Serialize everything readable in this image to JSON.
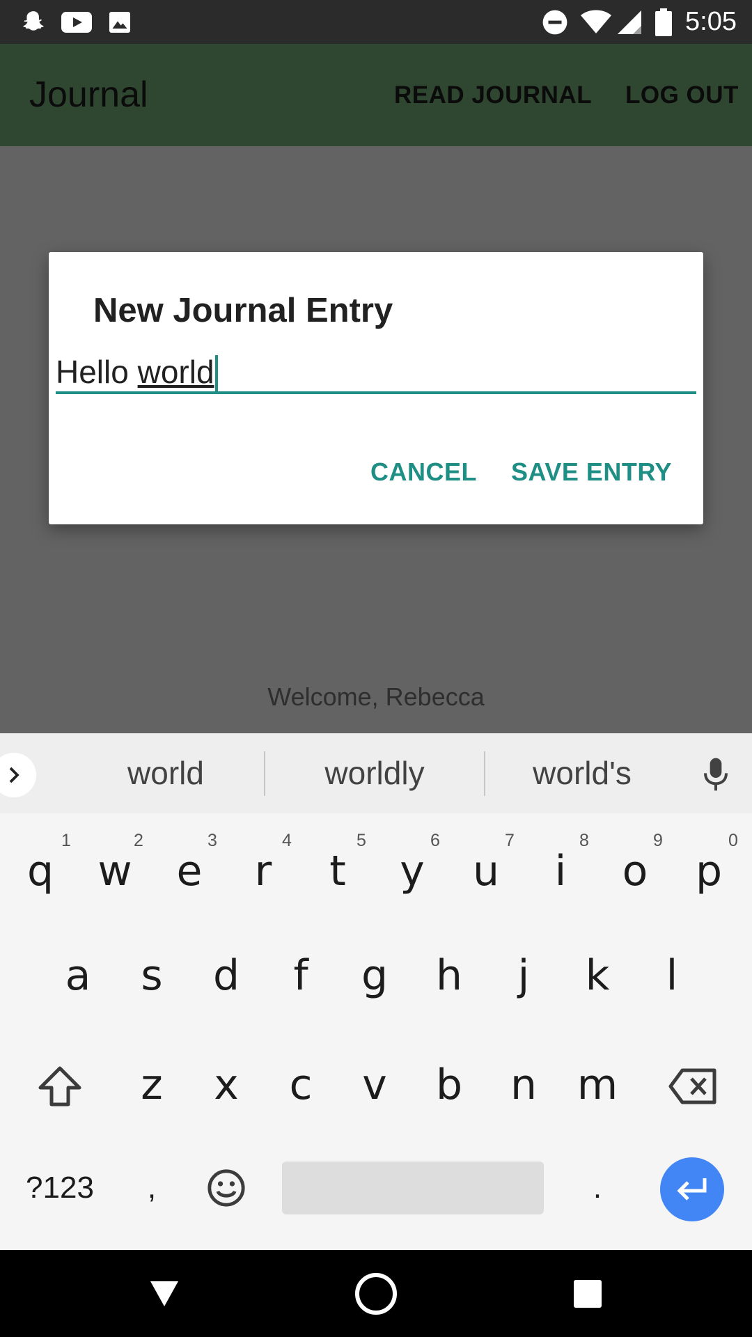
{
  "status_bar": {
    "time": "5:05",
    "left_icons": [
      "snapchat-icon",
      "youtube-icon",
      "image-icon"
    ],
    "right_icons": [
      "do-not-disturb-icon",
      "wifi-icon",
      "signal-icon",
      "battery-icon"
    ]
  },
  "app_bar": {
    "title": "Journal",
    "actions": [
      "READ JOURNAL",
      "LOG OUT"
    ],
    "color": "#2f4730"
  },
  "main": {
    "welcome_text": "Welcome, Rebecca"
  },
  "dialog": {
    "title": "New Journal Entry",
    "input_value_plain": "Hello ",
    "input_value_composing": "world",
    "cancel_label": "CANCEL",
    "save_label": "SAVE ENTRY",
    "accent_color": "#1f8f86"
  },
  "keyboard": {
    "suggestions": [
      "world",
      "worldly",
      "world's"
    ],
    "row1": [
      {
        "key": "q",
        "hint": "1"
      },
      {
        "key": "w",
        "hint": "2"
      },
      {
        "key": "e",
        "hint": "3"
      },
      {
        "key": "r",
        "hint": "4"
      },
      {
        "key": "t",
        "hint": "5"
      },
      {
        "key": "y",
        "hint": "6"
      },
      {
        "key": "u",
        "hint": "7"
      },
      {
        "key": "i",
        "hint": "8"
      },
      {
        "key": "o",
        "hint": "9"
      },
      {
        "key": "p",
        "hint": "0"
      }
    ],
    "row2": [
      "a",
      "s",
      "d",
      "f",
      "g",
      "h",
      "j",
      "k",
      "l"
    ],
    "row3": [
      "z",
      "x",
      "c",
      "v",
      "b",
      "n",
      "m"
    ],
    "symbols_label": "?123",
    "comma_label": ",",
    "period_label": ".",
    "enter_color": "#4285f4"
  },
  "nav_bar": {
    "buttons": [
      "back-icon",
      "home-icon",
      "recents-icon"
    ]
  }
}
